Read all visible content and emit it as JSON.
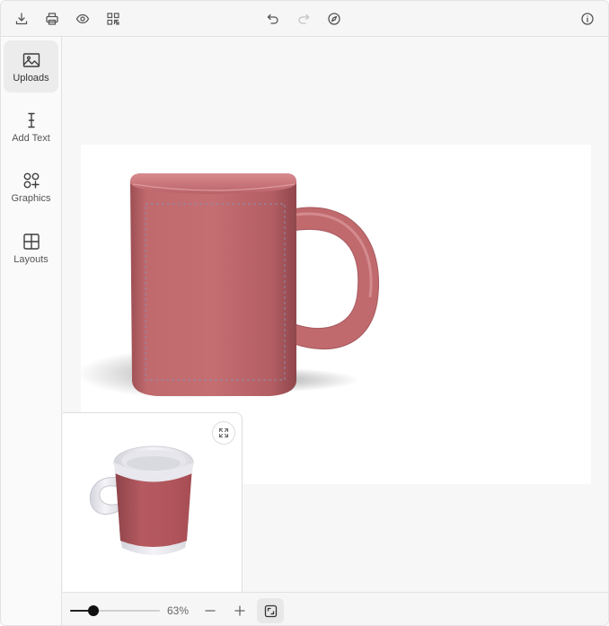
{
  "toolbar": {
    "left_icons": [
      "download-icon",
      "print-icon",
      "eye-icon",
      "qr-code-icon"
    ],
    "center_icons": [
      "undo-icon",
      "redo-icon",
      "compass-icon"
    ],
    "right_icons": [
      "info-icon"
    ],
    "redo_disabled": true
  },
  "sidebar": {
    "items": [
      {
        "label": "Uploads",
        "icon": "image-icon",
        "active": true
      },
      {
        "label": "Add Text",
        "icon": "text-cursor-icon",
        "active": false
      },
      {
        "label": "Graphics",
        "icon": "shapes-icon",
        "active": false
      },
      {
        "label": "Layouts",
        "icon": "grid-icon",
        "active": false
      }
    ]
  },
  "product": {
    "mug_color": "#c06a6e",
    "inner_color": "#ffffff"
  },
  "zoom": {
    "value": "63%",
    "level": 0.26
  },
  "colors": {
    "accent": "#111111",
    "toolbar_bg": "#f6f6f6"
  }
}
